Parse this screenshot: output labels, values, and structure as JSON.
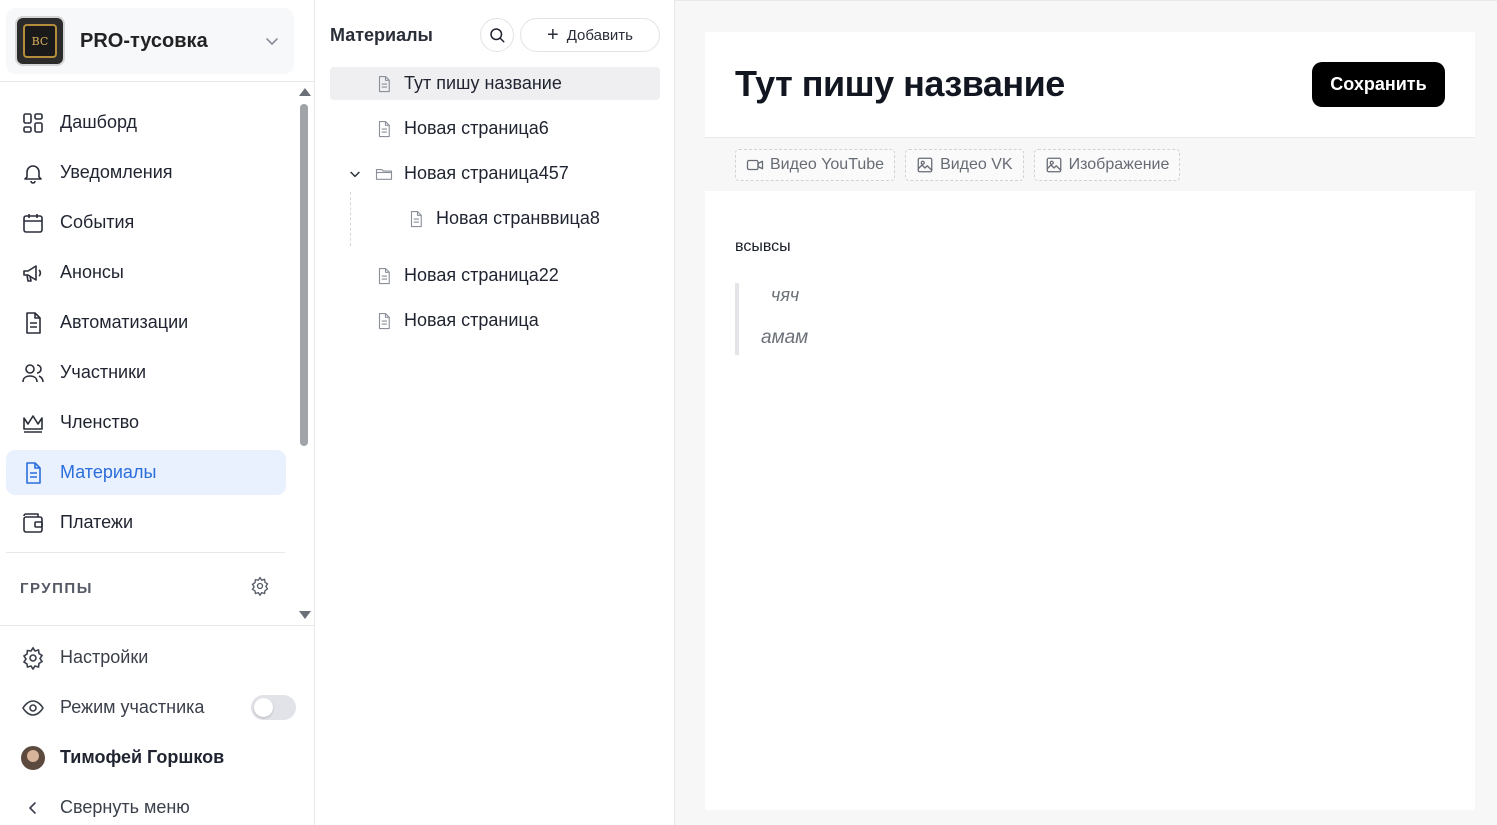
{
  "org": {
    "name": "PRO-тусовка",
    "logo_text": "BC"
  },
  "nav": [
    {
      "label": "Дашборд",
      "icon": "dashboard-icon"
    },
    {
      "label": "Уведомления",
      "icon": "bell-icon"
    },
    {
      "label": "События",
      "icon": "calendar-icon"
    },
    {
      "label": "Анонсы",
      "icon": "megaphone-icon"
    },
    {
      "label": "Автоматизации",
      "icon": "document-icon"
    },
    {
      "label": "Участники",
      "icon": "users-icon"
    },
    {
      "label": "Членство",
      "icon": "crown-icon"
    },
    {
      "label": "Материалы",
      "icon": "document-icon",
      "active": true
    },
    {
      "label": "Платежи",
      "icon": "wallet-icon"
    }
  ],
  "groups": {
    "label": "ГРУППЫ"
  },
  "bottom": {
    "settings": "Настройки",
    "member_mode": "Режим участника",
    "member_mode_on": false,
    "user_name": "Тимофей Горшков",
    "collapse": "Свернуть меню"
  },
  "materials": {
    "title": "Материалы",
    "add_label": "Добавить",
    "tree": [
      {
        "label": "Тут пишу название",
        "type": "page",
        "selected": true
      },
      {
        "label": "Новая страница6",
        "type": "page"
      },
      {
        "label": "Новая страница457",
        "type": "folder",
        "expanded": true
      },
      {
        "label": "Новая странввица8",
        "type": "page",
        "child": true
      },
      {
        "label": "Новая страница22",
        "type": "page"
      },
      {
        "label": "Новая страница",
        "type": "page"
      }
    ]
  },
  "editor": {
    "title": "Тут пишу название",
    "save_label": "Сохранить",
    "tools": [
      {
        "label": "Видео YouTube",
        "icon": "video-icon"
      },
      {
        "label": "Видео VK",
        "icon": "image-icon"
      },
      {
        "label": "Изображение",
        "icon": "image-icon"
      }
    ],
    "paragraph": "всывсы",
    "quote_lines": [
      "чяч",
      "амам"
    ]
  },
  "colors": {
    "accent": "#2a6edb",
    "active_bg": "#e9f1fe",
    "save_bg": "#000000"
  }
}
